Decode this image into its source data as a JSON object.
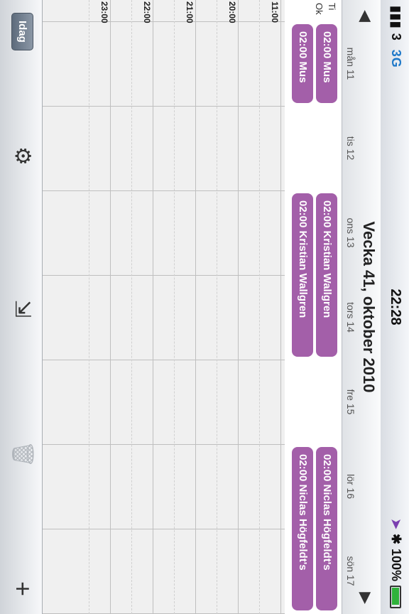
{
  "status": {
    "carrier": "3",
    "network": "3G",
    "time": "22:28",
    "battery": "100%",
    "icons": [
      "signal-icon",
      "location-arrow-icon",
      "bluetooth-icon",
      "battery-icon"
    ]
  },
  "header": {
    "title": "Vecka 41, oktober 2010",
    "prev_icon": "triangle-left-icon",
    "next_icon": "triangle-right-icon"
  },
  "days": [
    "mån 11",
    "tis 12",
    "ons 13",
    "tors 14",
    "fre 15",
    "lör 16",
    "sön 17"
  ],
  "allday": {
    "label_top": "Ti",
    "label_bottom": "Ok",
    "events": [
      {
        "text": "02:00 Mus",
        "row": 0,
        "day_start": 0,
        "day_span": 1
      },
      {
        "text": "02:00 Mus",
        "row": 1,
        "day_start": 0,
        "day_span": 1
      },
      {
        "text": "02:00 Kristian Wallgren",
        "row": 0,
        "day_start": 2,
        "day_span": 2
      },
      {
        "text": "02:00 Kristian Wallgren",
        "row": 1,
        "day_start": 2,
        "day_span": 2
      },
      {
        "text": "02:00 Niclas Högfeldt's",
        "row": 0,
        "day_start": 5,
        "day_span": 2
      },
      {
        "text": "02:00 Niclas Högfeldt's",
        "row": 1,
        "day_start": 5,
        "day_span": 2
      }
    ]
  },
  "hours": [
    "11:00",
    "20:00",
    "21:00",
    "22:00",
    "23:00"
  ],
  "toolbar": {
    "today_label": "Idag",
    "icons": [
      "gear-icon",
      "export-icon",
      "trash-icon",
      "plus-icon"
    ]
  },
  "colors": {
    "event": "#a35fa9",
    "grid_bg": "#f0f0f0"
  }
}
